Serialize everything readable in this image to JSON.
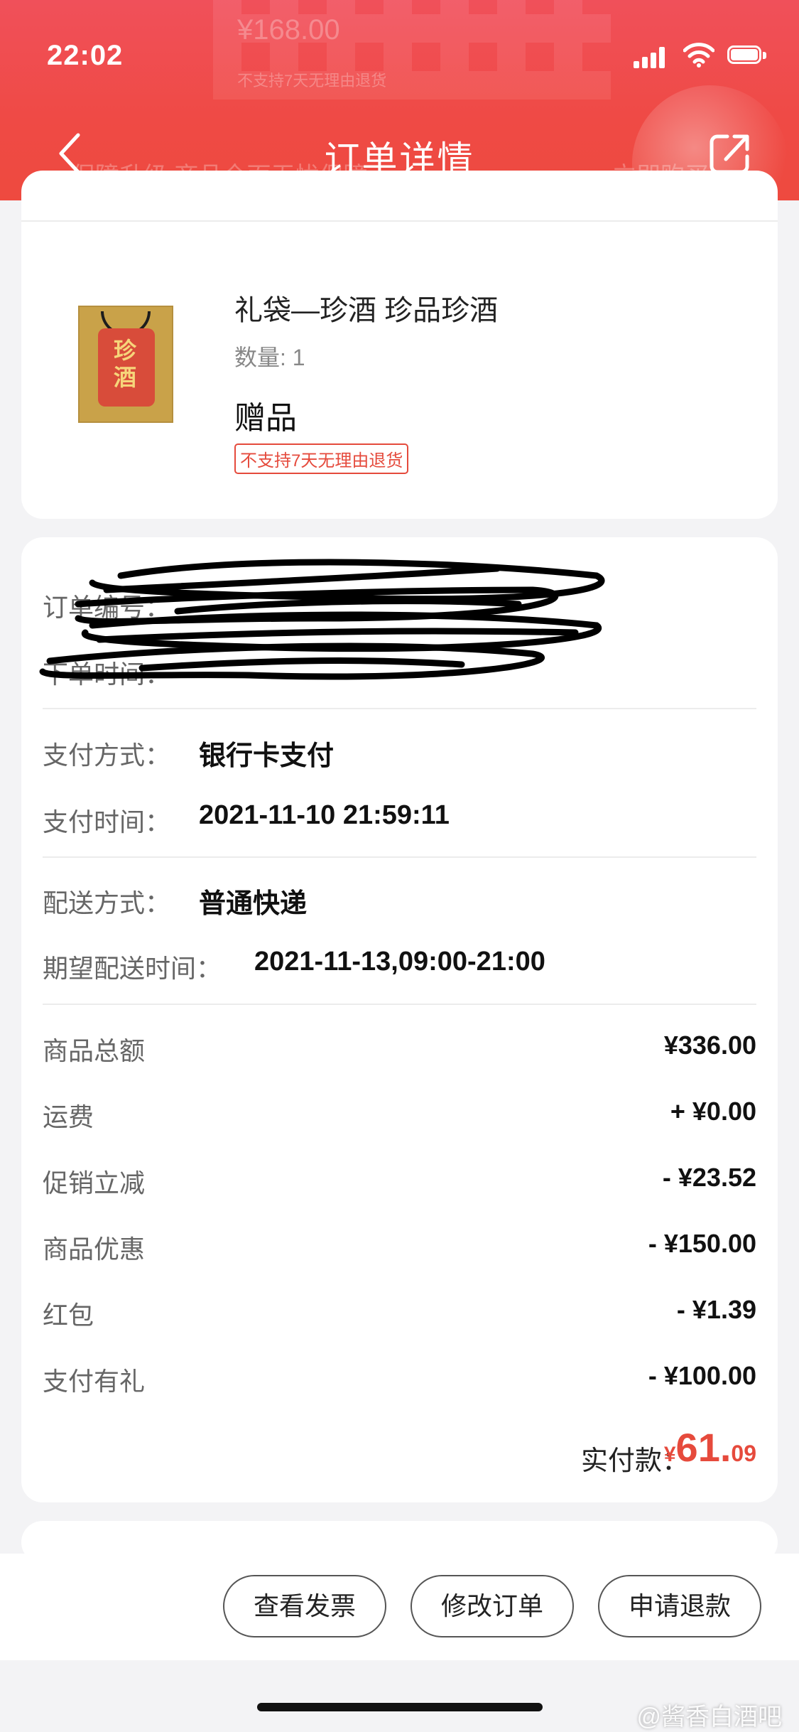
{
  "status_bar": {
    "time": "22:02"
  },
  "header": {
    "title": "订单详情",
    "ghost_price": "¥168.00",
    "ghost_notice": "不支持7天无理由退货",
    "ghost_banner_left": "保障升级  商品全面无忧保障",
    "ghost_banner_right": "立即购买"
  },
  "product": {
    "name": "礼袋—珍酒 珍品珍酒",
    "quantity": "数量: 1",
    "tag": "赠品",
    "badge": "不支持7天无理由退货",
    "image_text": "珍酒"
  },
  "order_info": {
    "order_no_label": "订单编号：",
    "order_time_label": "下单时间："
  },
  "payment": {
    "method_label": "支付方式：",
    "method_value": "银行卡支付",
    "time_label": "支付时间：",
    "time_value": "2021-11-10 21:59:11"
  },
  "delivery": {
    "method_label": "配送方式：",
    "method_value": "普通快递",
    "expected_label": "期望配送时间：",
    "expected_value": "2021-11-13,09:00-21:00"
  },
  "amounts": [
    {
      "label": "商品总额",
      "value": "¥336.00"
    },
    {
      "label": "运费",
      "value": "+ ¥0.00"
    },
    {
      "label": "促销立减",
      "value": "- ¥23.52"
    },
    {
      "label": "商品优惠",
      "value": "- ¥150.00"
    },
    {
      "label": "红包",
      "value": "- ¥1.39"
    },
    {
      "label": "支付有礼",
      "value": "- ¥100.00"
    }
  ],
  "paid": {
    "label": "实付款：",
    "currency": "¥",
    "integer": "61.",
    "decimal": "09"
  },
  "buttons": {
    "invoice": "查看发票",
    "modify": "修改订单",
    "refund": "申请退款"
  },
  "watermark": "@酱香白酒吧",
  "colors": {
    "header": "#ef4a45",
    "accent_red": "#e64a3c",
    "background": "#f3f3f5"
  }
}
